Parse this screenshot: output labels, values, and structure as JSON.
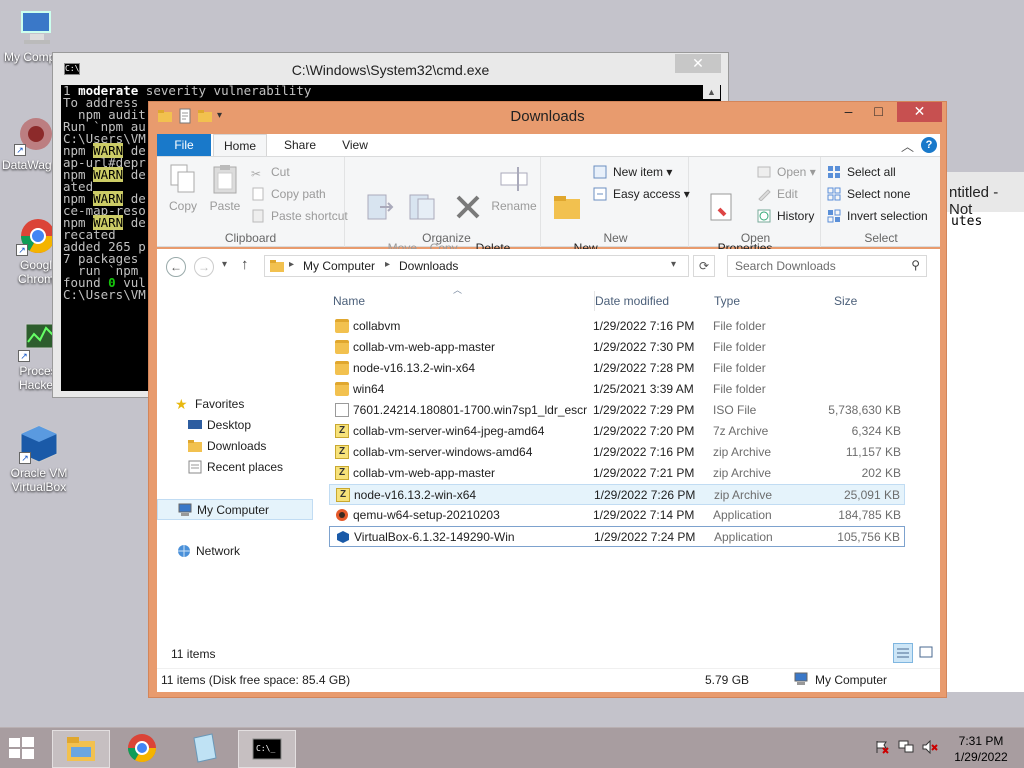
{
  "desktop": {
    "icons": [
      {
        "label": "My Comp"
      },
      {
        "label": "DataWag"
      },
      {
        "label": "Googl\nChrom"
      },
      {
        "label": "Proces\nHacker"
      },
      {
        "label": "Oracle VM\nVirtualBox"
      }
    ]
  },
  "notepad": {
    "title": "ntitled - Not",
    "text": "utes"
  },
  "cmd": {
    "title": "C:\\Windows\\System32\\cmd.exe",
    "lines": [
      "1 moderate severity vulnerability",
      "",
      "To address",
      "  npm audit",
      "",
      "Run `npm au",
      "",
      "C:\\Users\\VM",
      "npm WARN de",
      "ap-url#depr",
      "npm WARN de",
      "ated",
      "npm WARN de",
      "ce-map-reso",
      "npm WARN de",
      "recated",
      "",
      "added 265 p",
      "",
      "7 packages",
      "  run `npm",
      "",
      "found 0 vul",
      "",
      "C:\\Users\\VM"
    ]
  },
  "explorer": {
    "title": "Downloads",
    "tabs": {
      "file": "File",
      "home": "Home",
      "share": "Share",
      "view": "View"
    },
    "ribbon": {
      "clipboard": {
        "label": "Clipboard",
        "copy": "Copy",
        "paste": "Paste",
        "cut": "Cut",
        "copy_path": "Copy path",
        "paste_shortcut": "Paste shortcut"
      },
      "organize": {
        "label": "Organize",
        "move_to": "Move\nto ▾",
        "copy_to": "Copy\nto ▾",
        "delete": "Delete\n▾",
        "rename": "Rename"
      },
      "new": {
        "label": "New",
        "new_folder": "New\nfolder",
        "new_item": "New item ▾",
        "easy_access": "Easy access ▾"
      },
      "open": {
        "label": "Open",
        "properties": "Properties\n▾",
        "open": "Open ▾",
        "edit": "Edit",
        "history": "History"
      },
      "select": {
        "label": "Select",
        "select_all": "Select all",
        "select_none": "Select none",
        "invert": "Invert selection"
      }
    },
    "address": {
      "crumb1": "My Computer",
      "crumb2": "Downloads",
      "search_placeholder": "Search Downloads"
    },
    "nav": {
      "favorites": "Favorites",
      "desktop": "Desktop",
      "downloads": "Downloads",
      "recent": "Recent places",
      "computer": "My Computer",
      "network": "Network"
    },
    "columns": {
      "name": "Name",
      "date": "Date modified",
      "type": "Type",
      "size": "Size"
    },
    "files": [
      {
        "name": "collabvm",
        "date": "1/29/2022 7:16 PM",
        "type": "File folder",
        "size": "",
        "icon": "folder"
      },
      {
        "name": "collab-vm-web-app-master",
        "date": "1/29/2022 7:30 PM",
        "type": "File folder",
        "size": "",
        "icon": "folder"
      },
      {
        "name": "node-v16.13.2-win-x64",
        "date": "1/29/2022 7:28 PM",
        "type": "File folder",
        "size": "",
        "icon": "folder"
      },
      {
        "name": "win64",
        "date": "1/25/2021 3:39 AM",
        "type": "File folder",
        "size": "",
        "icon": "folder"
      },
      {
        "name": "7601.24214.180801-1700.win7sp1_ldr_escr...",
        "date": "1/29/2022 7:29 PM",
        "type": "ISO File",
        "size": "5,738,630 KB",
        "icon": "iso"
      },
      {
        "name": "collab-vm-server-win64-jpeg-amd64",
        "date": "1/29/2022 7:20 PM",
        "type": "7z Archive",
        "size": "6,324 KB",
        "icon": "zip"
      },
      {
        "name": "collab-vm-server-windows-amd64",
        "date": "1/29/2022 7:16 PM",
        "type": "zip Archive",
        "size": "11,157 KB",
        "icon": "zip"
      },
      {
        "name": "collab-vm-web-app-master",
        "date": "1/29/2022 7:21 PM",
        "type": "zip Archive",
        "size": "202 KB",
        "icon": "zip"
      },
      {
        "name": "node-v16.13.2-win-x64",
        "date": "1/29/2022 7:26 PM",
        "type": "zip Archive",
        "size": "25,091 KB",
        "icon": "zip"
      },
      {
        "name": "qemu-w64-setup-20210203",
        "date": "1/29/2022 7:14 PM",
        "type": "Application",
        "size": "184,785 KB",
        "icon": "qemu"
      },
      {
        "name": "VirtualBox-6.1.32-149290-Win",
        "date": "1/29/2022 7:24 PM",
        "type": "Application",
        "size": "105,756 KB",
        "icon": "vbox"
      }
    ],
    "item_count": "11 items",
    "status": {
      "left": "11 items (Disk free space: 85.4 GB)",
      "size": "5.79 GB",
      "location": "My Computer"
    }
  },
  "taskbar": {
    "time": "7:31 PM",
    "date": "1/29/2022"
  }
}
